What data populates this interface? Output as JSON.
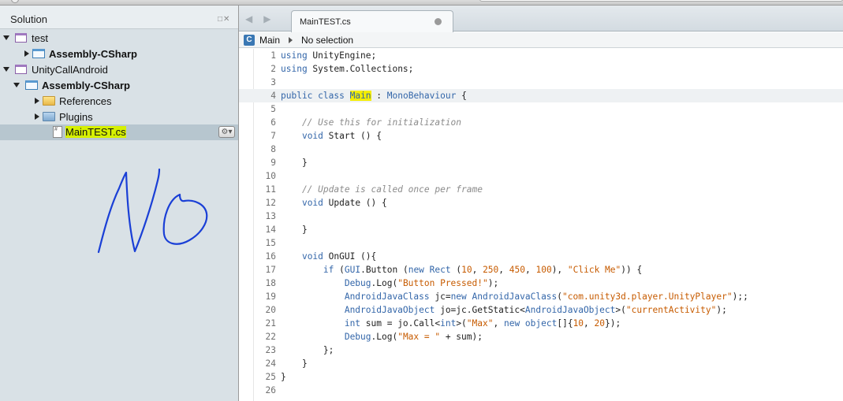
{
  "sidebar": {
    "title": "Solution",
    "header_controls": "□✕",
    "tree": [
      {
        "label": "test",
        "bold": false,
        "expanded": true,
        "icon": "solution-icon"
      },
      {
        "label": "Assembly-CSharp",
        "bold": true,
        "expanded": false,
        "icon": "project-icon"
      },
      {
        "label": "UnityCallAndroid",
        "bold": false,
        "expanded": true,
        "icon": "solution-icon"
      },
      {
        "label": "Assembly-CSharp",
        "bold": true,
        "expanded": true,
        "icon": "project-icon"
      },
      {
        "label": "References",
        "bold": false,
        "expanded": false,
        "icon": "folder-icon"
      },
      {
        "label": "Plugins",
        "bold": false,
        "expanded": false,
        "icon": "folder-icon"
      },
      {
        "label": "MainTEST.cs",
        "bold": false,
        "selected": true,
        "highlighted": true,
        "icon": "cs-file-icon"
      }
    ],
    "gear_button": "⚙▾",
    "annotation": "No"
  },
  "editor": {
    "nav_arrows": "◀▶",
    "tab": {
      "label": "MainTEST.cs"
    },
    "pathbar": {
      "class_icon": "C",
      "class_name": "Main",
      "member": "No selection"
    },
    "current_line": 4,
    "lines": [
      [
        {
          "t": "using ",
          "c": "kw"
        },
        {
          "t": "UnityEngine;",
          "c": "nm"
        }
      ],
      [
        {
          "t": "using ",
          "c": "kw"
        },
        {
          "t": "System.Collections;",
          "c": "nm"
        }
      ],
      [],
      [
        {
          "t": "public ",
          "c": "kw"
        },
        {
          "t": "class",
          "c": "kw"
        },
        {
          "t": " ",
          "c": "nm"
        },
        {
          "t": "Main",
          "c": "kw",
          "h": true
        },
        {
          "t": " : ",
          "c": "nm"
        },
        {
          "t": "MonoBehaviour",
          "c": "ty"
        },
        {
          "t": " {",
          "c": "nm"
        }
      ],
      [],
      [
        {
          "t": "    // Use this for initialization",
          "c": "cm"
        }
      ],
      [
        {
          "t": "    ",
          "c": "nm"
        },
        {
          "t": "void ",
          "c": "kw"
        },
        {
          "t": "Start () {",
          "c": "nm"
        }
      ],
      [],
      [
        {
          "t": "    }",
          "c": "nm"
        }
      ],
      [],
      [
        {
          "t": "    // Update is called once per frame",
          "c": "cm"
        }
      ],
      [
        {
          "t": "    ",
          "c": "nm"
        },
        {
          "t": "void ",
          "c": "kw"
        },
        {
          "t": "Update () {",
          "c": "nm"
        }
      ],
      [],
      [
        {
          "t": "    }",
          "c": "nm"
        }
      ],
      [],
      [
        {
          "t": "    ",
          "c": "nm"
        },
        {
          "t": "void ",
          "c": "kw"
        },
        {
          "t": "OnGUI ()",
          "c": "nm"
        },
        {
          "t": "{",
          "c": "nm"
        }
      ],
      [
        {
          "t": "        ",
          "c": "nm"
        },
        {
          "t": "if",
          "c": "kw"
        },
        {
          "t": " (",
          "c": "nm"
        },
        {
          "t": "GUI",
          "c": "ty"
        },
        {
          "t": ".Button (",
          "c": "nm"
        },
        {
          "t": "new ",
          "c": "kw"
        },
        {
          "t": "Rect",
          "c": "ty"
        },
        {
          "t": " (",
          "c": "nm"
        },
        {
          "t": "10",
          "c": "num"
        },
        {
          "t": ", ",
          "c": "nm"
        },
        {
          "t": "250",
          "c": "num"
        },
        {
          "t": ", ",
          "c": "nm"
        },
        {
          "t": "450",
          "c": "num"
        },
        {
          "t": ", ",
          "c": "nm"
        },
        {
          "t": "100",
          "c": "num"
        },
        {
          "t": "), ",
          "c": "nm"
        },
        {
          "t": "\"Click Me\"",
          "c": "str"
        },
        {
          "t": ")) {",
          "c": "nm"
        }
      ],
      [
        {
          "t": "            ",
          "c": "nm"
        },
        {
          "t": "Debug",
          "c": "ty"
        },
        {
          "t": ".Log(",
          "c": "nm"
        },
        {
          "t": "\"Button Pressed!\"",
          "c": "str"
        },
        {
          "t": ");",
          "c": "nm"
        }
      ],
      [
        {
          "t": "            ",
          "c": "nm"
        },
        {
          "t": "AndroidJavaClass",
          "c": "ty"
        },
        {
          "t": " jc=",
          "c": "nm"
        },
        {
          "t": "new ",
          "c": "kw"
        },
        {
          "t": "AndroidJavaClass",
          "c": "ty"
        },
        {
          "t": "(",
          "c": "nm"
        },
        {
          "t": "\"com.unity3d.player.UnityPlayer\"",
          "c": "str"
        },
        {
          "t": ");;",
          "c": "nm"
        }
      ],
      [
        {
          "t": "            ",
          "c": "nm"
        },
        {
          "t": "AndroidJavaObject",
          "c": "ty"
        },
        {
          "t": " jo=jc.GetStatic<",
          "c": "nm"
        },
        {
          "t": "AndroidJavaObject",
          "c": "ty"
        },
        {
          "t": ">(",
          "c": "nm"
        },
        {
          "t": "\"currentActivity\"",
          "c": "str"
        },
        {
          "t": ");",
          "c": "nm"
        }
      ],
      [
        {
          "t": "            ",
          "c": "nm"
        },
        {
          "t": "int",
          "c": "kw"
        },
        {
          "t": " sum = jo.Call<",
          "c": "nm"
        },
        {
          "t": "int",
          "c": "kw"
        },
        {
          "t": ">(",
          "c": "nm"
        },
        {
          "t": "\"Max\"",
          "c": "str"
        },
        {
          "t": ", ",
          "c": "nm"
        },
        {
          "t": "new ",
          "c": "kw"
        },
        {
          "t": "object",
          "c": "kw"
        },
        {
          "t": "[]{",
          "c": "nm"
        },
        {
          "t": "10",
          "c": "num"
        },
        {
          "t": ", ",
          "c": "nm"
        },
        {
          "t": "20",
          "c": "num"
        },
        {
          "t": "});",
          "c": "nm"
        }
      ],
      [
        {
          "t": "            ",
          "c": "nm"
        },
        {
          "t": "Debug",
          "c": "ty"
        },
        {
          "t": ".Log(",
          "c": "nm"
        },
        {
          "t": "\"Max = \"",
          "c": "str"
        },
        {
          "t": " + sum);",
          "c": "nm"
        }
      ],
      [
        {
          "t": "        };",
          "c": "nm"
        }
      ],
      [
        {
          "t": "    }",
          "c": "nm"
        }
      ],
      [
        {
          "t": "}",
          "c": "nm"
        }
      ],
      []
    ]
  },
  "colors": {
    "sidebar_bg": "#d9e1e6",
    "selection": "#b7c6cf",
    "highlighter_green": "#d6f000",
    "highlighter_yellow": "#f5ee00",
    "keyword": "#3366a9",
    "string": "#c75b00",
    "comment": "#8b8b8b",
    "ink": "#1a3fd6"
  }
}
